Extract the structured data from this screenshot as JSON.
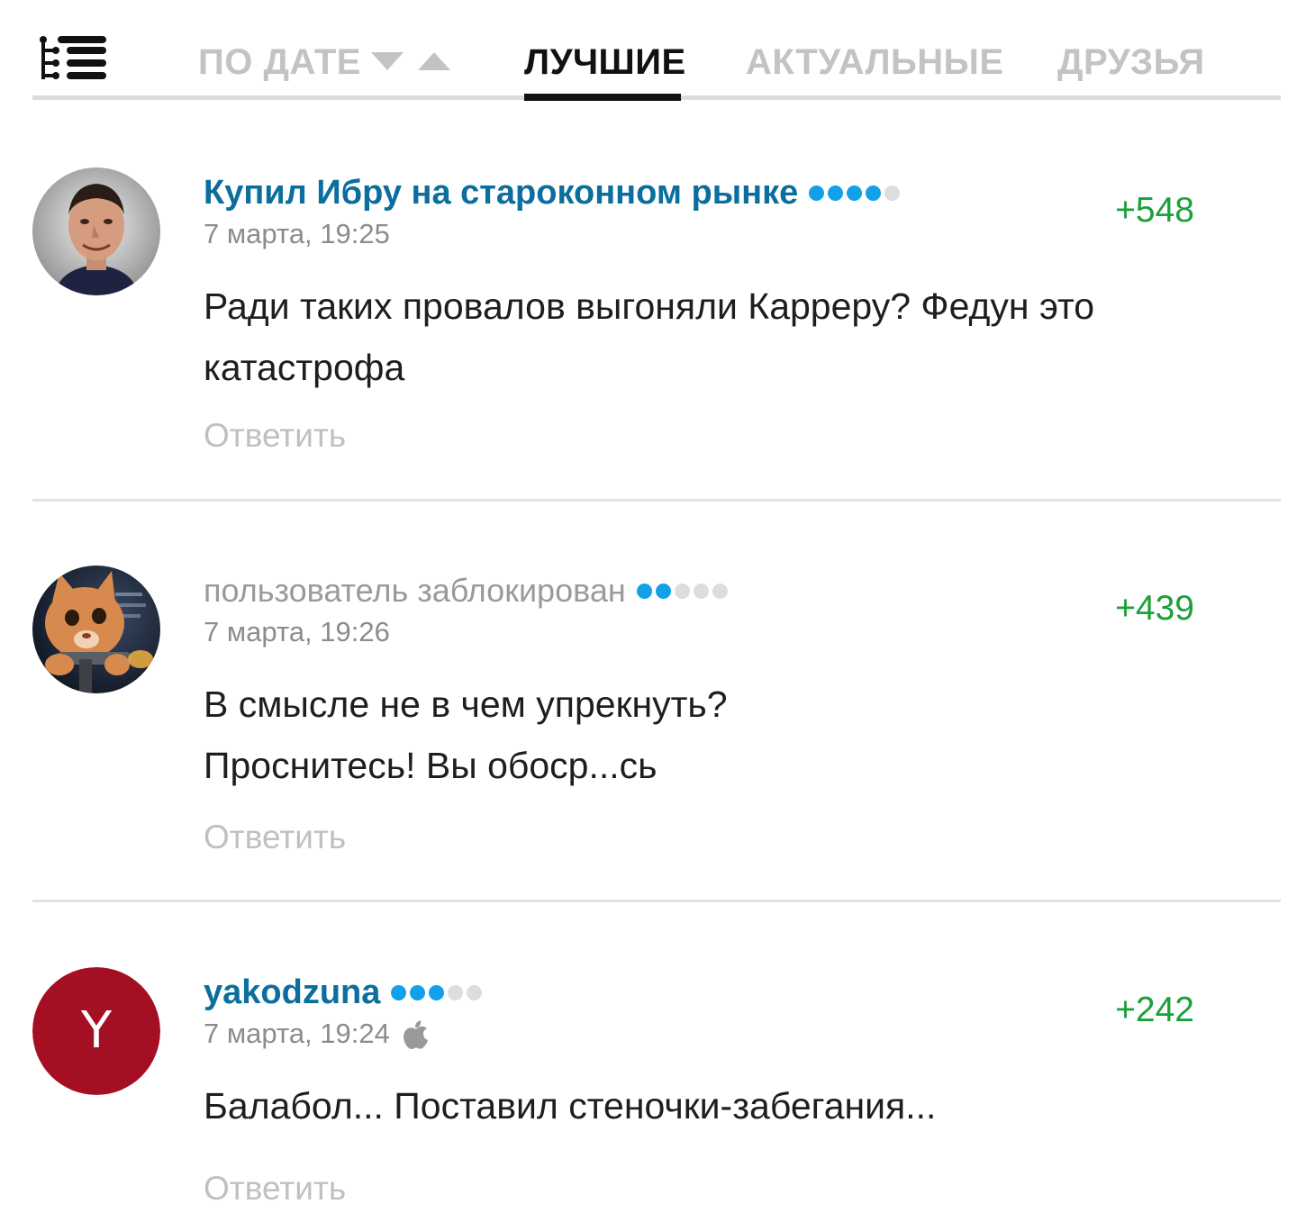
{
  "tabs": {
    "by_date": "ПО ДАТЕ",
    "best": "ЛУЧШИЕ",
    "actual": "АКТУАЛЬНЫЕ",
    "friends": "ДРУЗЬЯ",
    "active_tab": "best"
  },
  "icons": {
    "tree": "tree-view-icon",
    "sort_down": "sort-down-icon",
    "sort_up": "sort-up-icon",
    "apple": "apple-icon"
  },
  "colors": {
    "author": "#0b6e9e",
    "score": "#1aa138",
    "rating_on": "#12a0e8",
    "rating_off": "#dddddd",
    "avatar_letter_bg": "#a50f24"
  },
  "comments": [
    {
      "author": "Купил Ибру на староконном рынке",
      "rating": 4,
      "rating_max": 5,
      "time": "7 марта, 19:25",
      "score": "+548",
      "text_lines": [
        "Ради таких провалов выгоняли Карреру? Федун это",
        "катастрофа"
      ],
      "reply": "Ответить"
    },
    {
      "author": "пользователь заблокирован",
      "rating": 2,
      "rating_max": 5,
      "time": "7 марта, 19:26",
      "score": "+439",
      "text_lines": [
        "В смысле не в чем упрекнуть?",
        "Проснитесь! Вы обоср...сь"
      ],
      "reply": "Ответить"
    },
    {
      "author": "yakodzuna",
      "avatar_letter": "Y",
      "rating": 3,
      "rating_max": 5,
      "time": "7 марта, 19:24",
      "score": "+242",
      "text_lines": [
        "Балабол... Поставил стеночки-забегания..."
      ],
      "reply": "Ответить"
    }
  ]
}
